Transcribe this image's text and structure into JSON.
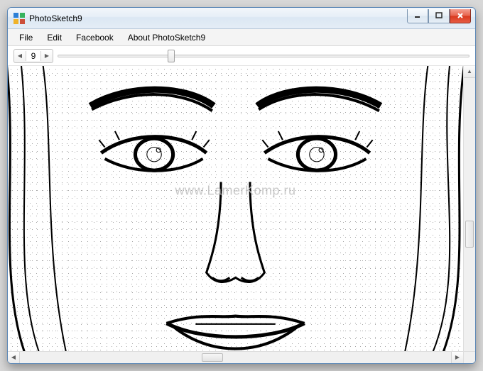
{
  "window": {
    "title": "PhotoSketch9"
  },
  "menu": {
    "items": [
      {
        "label": "File"
      },
      {
        "label": "Edit"
      },
      {
        "label": "Facebook"
      },
      {
        "label": "About PhotoSketch9"
      }
    ]
  },
  "toolbar": {
    "stepper": {
      "value": "9",
      "min": 1,
      "max": 30
    },
    "slider": {
      "value": 9,
      "min": 1,
      "max": 30
    }
  },
  "canvas": {
    "watermark": "www.LamerKomp.ru"
  },
  "scroll": {
    "vertical": {
      "position": 0.6,
      "size": 0.15
    },
    "horizontal": {
      "position": 0.5,
      "size": 0.1
    }
  },
  "colors": {
    "chrome_border": "#5a86b5",
    "close_red": "#d9371b"
  }
}
